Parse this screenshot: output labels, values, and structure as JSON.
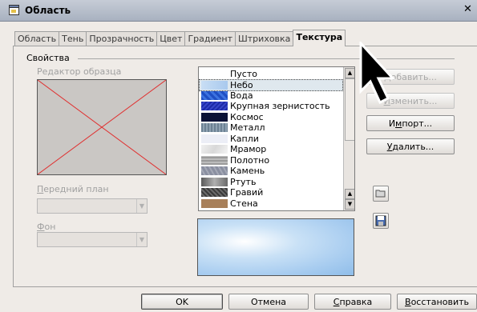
{
  "window": {
    "title": "Область",
    "close": "✕"
  },
  "tabs": [
    {
      "label": "Область",
      "active": false
    },
    {
      "label": "Тень",
      "active": false
    },
    {
      "label": "Прозрачность",
      "active": false
    },
    {
      "label": "Цвет",
      "active": false
    },
    {
      "label": "Градиент",
      "active": false
    },
    {
      "label": "Штриховка",
      "active": false
    },
    {
      "label": "Текстура",
      "active": true
    }
  ],
  "properties": {
    "group_label": "Свойства",
    "editor_label": "Редактор образца",
    "foreground_label": "Передний план",
    "background_label": "Фон"
  },
  "texture_list": {
    "selected": "Небо",
    "items": [
      {
        "label": "Пусто",
        "swatch": "#ffffff"
      },
      {
        "label": "Небо",
        "swatch": "#bcd7f1"
      },
      {
        "label": "Вода",
        "swatch": "#1f4fc4"
      },
      {
        "label": "Крупная зернистость",
        "swatch": "#1d2aa8"
      },
      {
        "label": "Космос",
        "swatch": "#0a1236"
      },
      {
        "label": "Металл",
        "swatch": "#6c8193"
      },
      {
        "label": "Капли",
        "swatch": "#e8eaf3"
      },
      {
        "label": "Мрамор",
        "swatch": "#e4e4e4"
      },
      {
        "label": "Полотно",
        "swatch": "#9a9a9a"
      },
      {
        "label": "Камень",
        "swatch": "#8a8fa0"
      },
      {
        "label": "Ртуть",
        "swatch": "#7c7c7c"
      },
      {
        "label": "Гравий",
        "swatch": "#4a4a4a"
      },
      {
        "label": "Стена",
        "swatch": "#a8805a"
      }
    ]
  },
  "side_buttons": {
    "add": "Добавить...",
    "modify": "Изменить...",
    "import": "Импорт...",
    "delete": "Удалить..."
  },
  "bottom_buttons": {
    "ok": "OK",
    "cancel": "Отмена",
    "help": "Справка",
    "reset": "Восстановить"
  },
  "icons": {
    "open": "folder-open-icon",
    "save": "save-icon",
    "window": "window-app-icon",
    "cursor": "mouse-pointer-icon"
  }
}
